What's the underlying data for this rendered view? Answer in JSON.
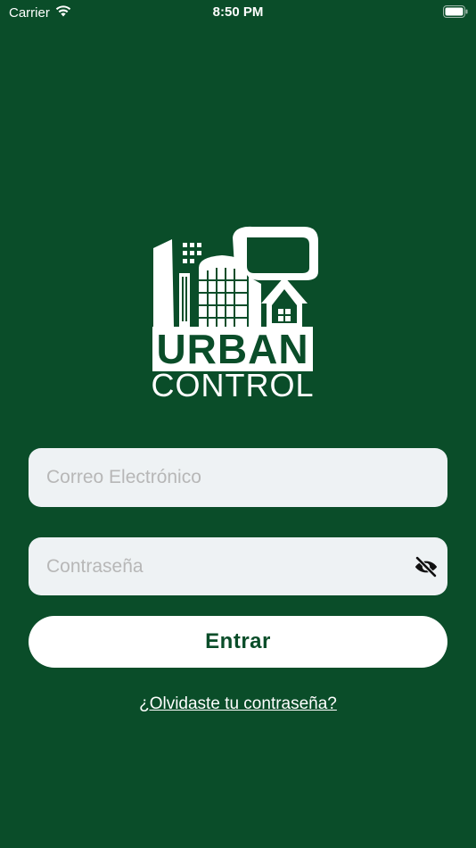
{
  "status_bar": {
    "carrier": "Carrier",
    "time": "8:50 PM",
    "wifi_icon": "wifi-icon",
    "battery_icon": "battery-icon"
  },
  "logo": {
    "line1": "URBAN",
    "line2": "CONTROL"
  },
  "form": {
    "email_placeholder": "Correo Electrónico",
    "email_value": "",
    "password_placeholder": "Contraseña",
    "password_value": "",
    "password_toggle_icon": "eye-slash-icon",
    "submit_label": "Entrar",
    "forgot_label": "¿Olvidaste tu contraseña?"
  },
  "colors": {
    "background": "#0a4d29",
    "field_background": "#eef2f4",
    "button_background": "#ffffff",
    "button_text": "#0a4d29",
    "placeholder": "#b7b7b7"
  }
}
